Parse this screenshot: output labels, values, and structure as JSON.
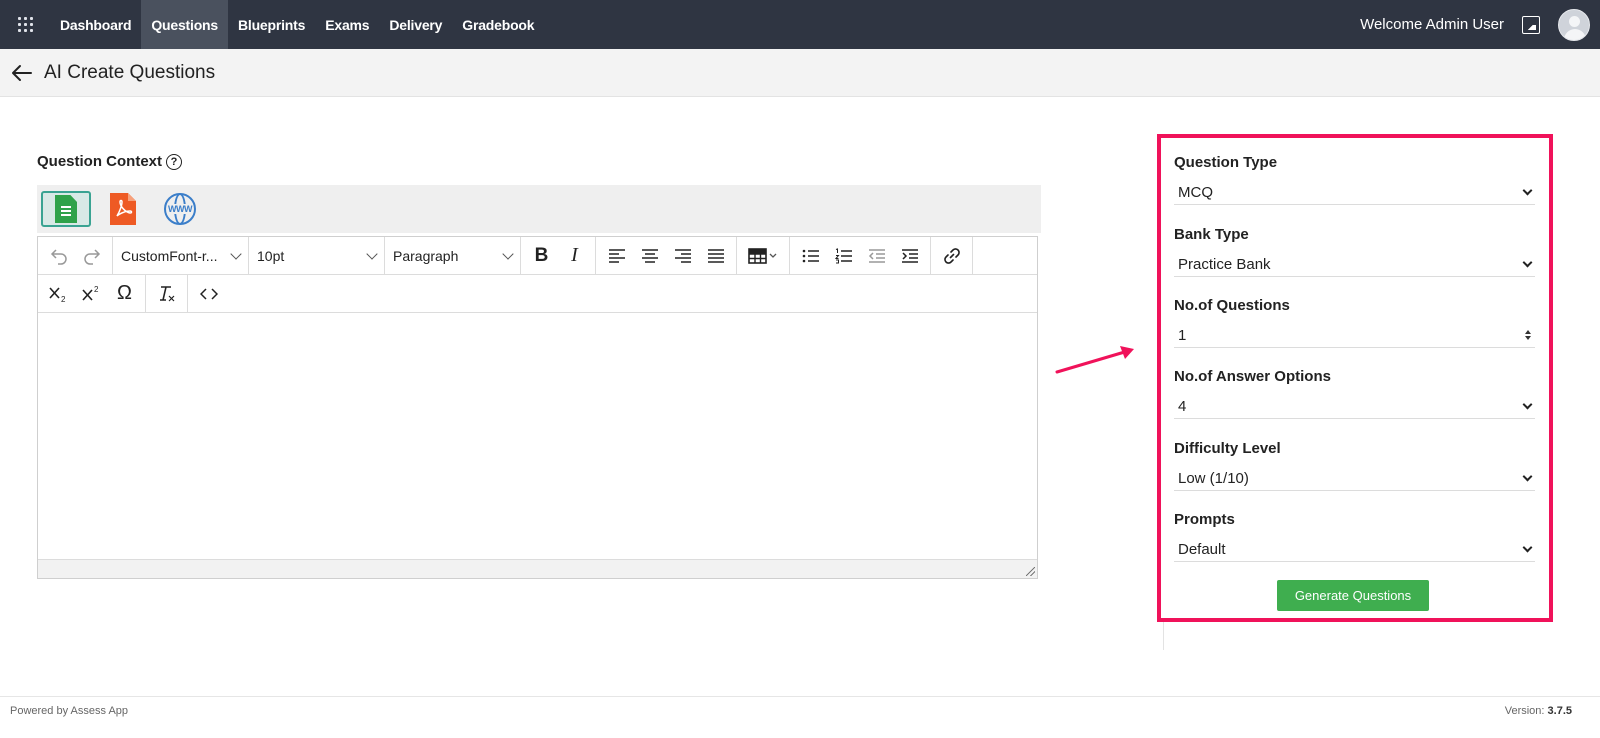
{
  "nav": {
    "items": [
      {
        "label": "Dashboard",
        "active": false
      },
      {
        "label": "Questions",
        "active": true
      },
      {
        "label": "Blueprints",
        "active": false
      },
      {
        "label": "Exams",
        "active": false
      },
      {
        "label": "Delivery",
        "active": false
      },
      {
        "label": "Gradebook",
        "active": false
      }
    ],
    "welcome": "Welcome Admin User"
  },
  "page": {
    "title": "AI Create Questions"
  },
  "context": {
    "label": "Question Context",
    "help_glyph": "?",
    "sources": [
      {
        "icon": "document-list-icon",
        "selected": true
      },
      {
        "icon": "pdf-icon",
        "selected": false
      },
      {
        "icon": "www-globe-icon",
        "selected": false
      }
    ],
    "www_text": "WWW"
  },
  "editor": {
    "font": "CustomFont-r...",
    "size": "10pt",
    "block": "Paragraph",
    "content": ""
  },
  "panel": {
    "question_type": {
      "label": "Question Type",
      "value": "MCQ"
    },
    "bank_type": {
      "label": "Bank Type",
      "value": "Practice Bank"
    },
    "num_questions": {
      "label": "No.of Questions",
      "value": "1"
    },
    "num_options": {
      "label": "No.of Answer Options",
      "value": "4"
    },
    "difficulty": {
      "label": "Difficulty Level",
      "value": "Low (1/10)"
    },
    "prompts": {
      "label": "Prompts",
      "value": "Default"
    },
    "generate_label": "Generate Questions"
  },
  "colors": {
    "nav_bg": "#2f3542",
    "highlight_border": "#f0125a",
    "primary_button": "#3fae4f"
  },
  "footer": {
    "powered": "Powered by Assess App",
    "version_label": "Version:",
    "version_value": "3.7.5"
  }
}
